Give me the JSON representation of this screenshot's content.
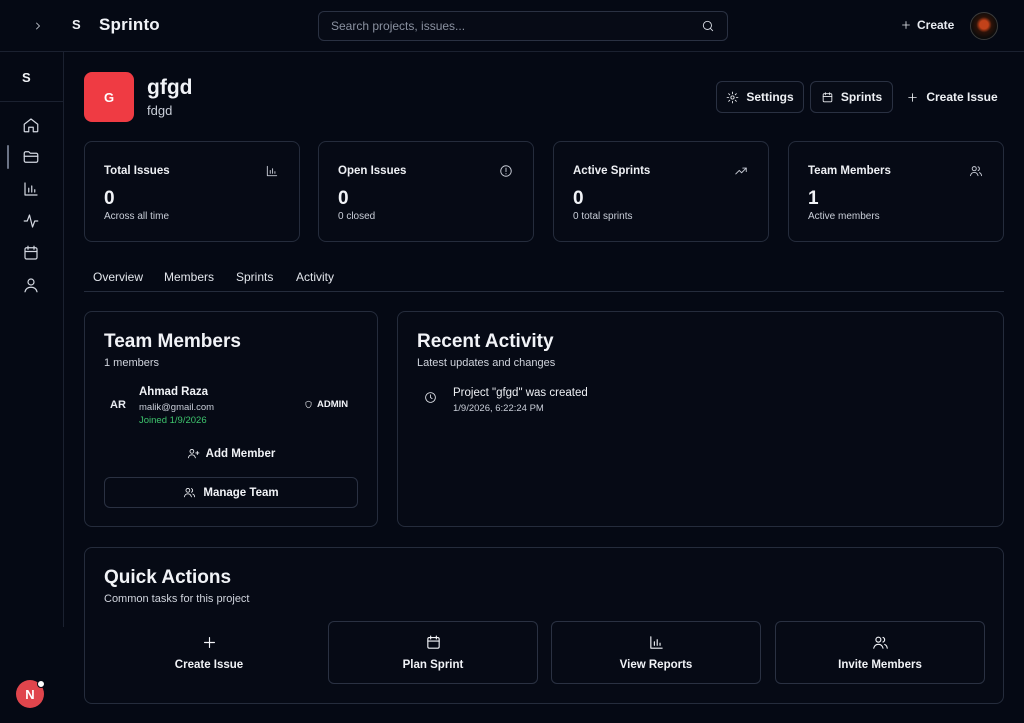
{
  "app": {
    "logo_letter": "S",
    "name": "Sprinto"
  },
  "topbar": {
    "search_placeholder": "Search projects, issues...",
    "create_label": "Create"
  },
  "sidebar": {
    "logo_letter": "S",
    "items": [
      "home-icon",
      "folder-icon",
      "bar-chart-icon",
      "activity-icon",
      "calendar-icon",
      "user-icon"
    ],
    "notification_letter": "N"
  },
  "project": {
    "avatar_letter": "G",
    "name": "gfgd",
    "key": "fdgd",
    "avatar_color": "#ef3b43",
    "buttons": {
      "settings": "Settings",
      "sprints": "Sprints",
      "create_issue": "Create Issue"
    }
  },
  "stats": [
    {
      "title": "Total Issues",
      "value": "0",
      "sub": "Across all time",
      "icon": "bar-chart-icon"
    },
    {
      "title": "Open Issues",
      "value": "0",
      "sub": "0 closed",
      "icon": "alert-circle-icon"
    },
    {
      "title": "Active Sprints",
      "value": "0",
      "sub": "0 total sprints",
      "icon": "trending-up-icon"
    },
    {
      "title": "Team Members",
      "value": "1",
      "sub": "Active members",
      "icon": "users-icon"
    }
  ],
  "tabs": [
    "Overview",
    "Members",
    "Sprints",
    "Activity"
  ],
  "team": {
    "title": "Team Members",
    "subtitle": "1 members",
    "member": {
      "initials": "AR",
      "name": "Ahmad Raza",
      "email": "malik@gmail.com",
      "joined": "Joined 1/9/2026",
      "role": "ADMIN"
    },
    "add_member": "Add Member",
    "manage_team": "Manage Team"
  },
  "activity": {
    "title": "Recent Activity",
    "subtitle": "Latest updates and changes",
    "items": [
      {
        "text": "Project \"gfgd\" was created",
        "time": "1/9/2026, 6:22:24 PM"
      }
    ]
  },
  "quick_actions": {
    "title": "Quick Actions",
    "subtitle": "Common tasks for this project",
    "items": [
      {
        "label": "Create Issue",
        "icon": "plus-icon"
      },
      {
        "label": "Plan Sprint",
        "icon": "calendar-icon"
      },
      {
        "label": "View Reports",
        "icon": "bar-chart-icon"
      },
      {
        "label": "Invite Members",
        "icon": "users-icon"
      }
    ]
  },
  "colors": {
    "background": "#050914",
    "accent_red": "#ef3b43",
    "joined_green": "#3ec46d",
    "border": "#252c3c"
  }
}
